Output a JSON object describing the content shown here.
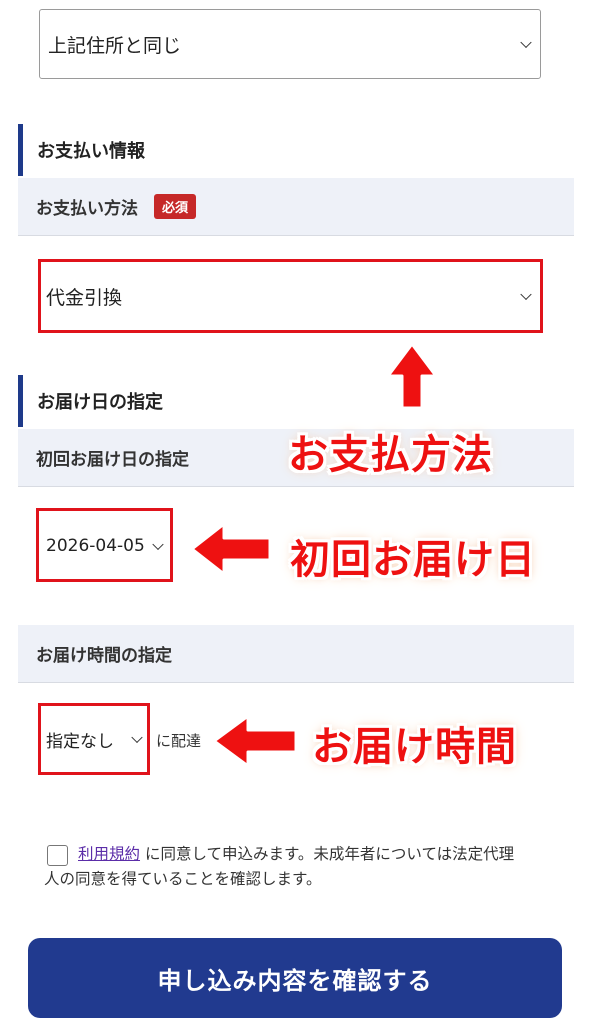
{
  "shipping": {
    "address_select_value": "上記住所と同じ"
  },
  "payment": {
    "section_title": "お支払い情報",
    "method_label": "お支払い方法",
    "required_badge": "必須",
    "method_value": "代金引換"
  },
  "delivery": {
    "section_title": "お届け日の指定",
    "first_date_label": "初回お届け日の指定",
    "first_date_value": "2026-04-05",
    "time_label": "お届け時間の指定",
    "time_value": "指定なし",
    "time_suffix": "に配達"
  },
  "annotations": {
    "payment_method": "お支払方法",
    "first_delivery_date": "初回お届け日",
    "delivery_time": "お届け時間"
  },
  "consent": {
    "terms_link": "利用規約",
    "text_line1": " に同意して申込みます。未成年者については法定代理",
    "text_line2": "人の同意を得ていることを確認します。"
  },
  "submit": {
    "label": "申し込み内容を確認する"
  },
  "colors": {
    "accent": "#1e3a8a",
    "badge": "#c62828",
    "highlight": "#e0131b",
    "submit_bg": "#213a8f"
  }
}
